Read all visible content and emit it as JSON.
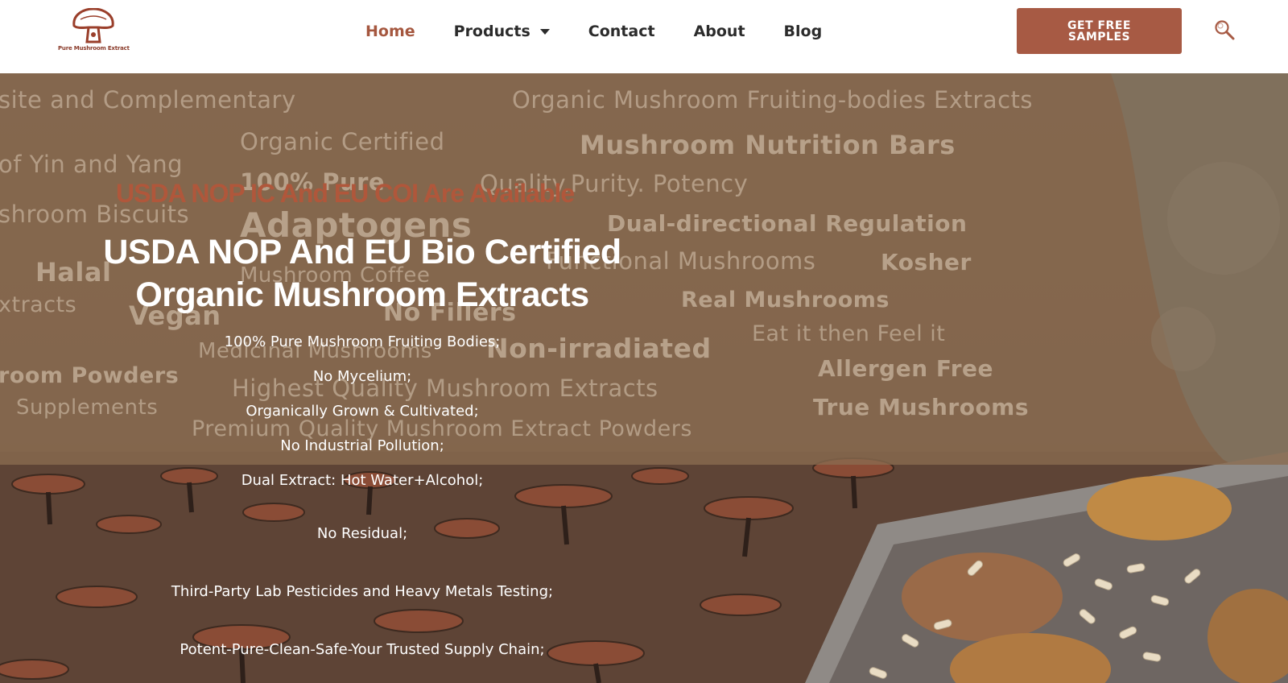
{
  "brand": {
    "logo_text": "Pure Mushroom Extract",
    "accent_color": "#a75a44"
  },
  "nav": {
    "items": [
      {
        "label": "Home",
        "active": true
      },
      {
        "label": "Products",
        "has_dropdown": true
      },
      {
        "label": "Contact"
      },
      {
        "label": "About"
      },
      {
        "label": "Blog"
      }
    ]
  },
  "header": {
    "cta_label": "GET FREE SAMPLES",
    "search_icon": "search-icon"
  },
  "hero": {
    "subtitle": "USDA NOP IC And EU COI Are Available",
    "title_line1": "USDA NOP And EU Bio Certified",
    "title_line2": "Organic Mushroom Extracts",
    "features": [
      "100% Pure Mushroom Fruiting Bodies;",
      "No Mycelium;",
      "Organically Grown & Cultivated;",
      "No Industrial Pollution;",
      "Dual Extract: Hot Water+Alcohol;",
      "No Residual;",
      "Third-Party Lab Pesticides and Heavy Metals Testing;",
      "Potent-Pure-Clean-Safe-Your Trusted Supply Chain;"
    ],
    "background_words": [
      "site and Complementary",
      "Organic Mushroom Fruiting-bodies Extracts",
      "Organic Certified",
      "Mushroom Nutrition Bars",
      "of Yin and Yang",
      "100% Pure",
      "Quality.Purity. Potency",
      "shroom Biscuits",
      "Adaptogens",
      "Dual-directional Regulation",
      "Halal",
      "Mushroom Coffee",
      "Functional Mushrooms",
      "Kosher",
      "xtracts",
      "Vegan",
      "No Fillers",
      "Real Mushrooms",
      "Eat it then Feel it",
      "Medicinal Mushrooms",
      "Non-irradiated",
      "room Powders",
      "Allergen Free",
      "Highest Quality Mushroom Extracts",
      "True Mushrooms",
      "Supplements",
      "Premium Quality Mushroom Extract Powders"
    ]
  }
}
